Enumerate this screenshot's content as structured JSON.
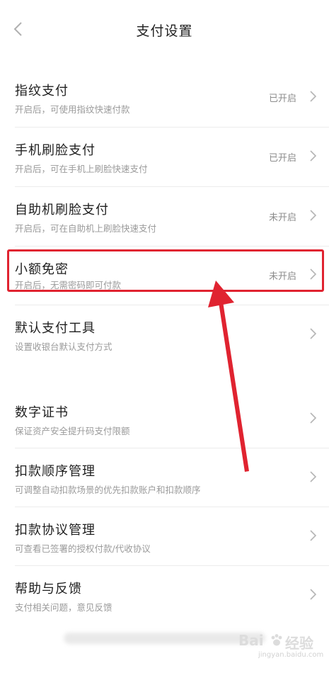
{
  "header": {
    "title": "支付设置"
  },
  "rows": [
    {
      "title": "指纹支付",
      "subtitle": "开启后，可使用指纹快速付款",
      "status": "已开启"
    },
    {
      "title": "手机刷脸支付",
      "subtitle": "开启后，可在手机上刷脸快速支付",
      "status": "已开启"
    },
    {
      "title": "自助机刷脸支付",
      "subtitle": "开启后，可在自助机上刷脸快速支付",
      "status": "未开启"
    },
    {
      "title": "小额免密",
      "subtitle": "开启后，无需密码即可付款",
      "status": "未开启"
    },
    {
      "title": "默认支付工具",
      "subtitle": "设置收银台默认支付方式",
      "status": ""
    },
    {
      "title": "数字证书",
      "subtitle": "保证资产安全提升码支付限额",
      "status": ""
    },
    {
      "title": "扣款顺序管理",
      "subtitle": "可调整自动扣款场景的优先扣款账户和扣款顺序",
      "status": ""
    },
    {
      "title": "扣款协议管理",
      "subtitle": "可查看已签署的授权付款/代收协议",
      "status": ""
    },
    {
      "title": "帮助与反馈",
      "subtitle": "支付相关问题，意见反馈",
      "status": ""
    }
  ],
  "watermark": {
    "brand": "Bai",
    "brand_suffix": "经验",
    "url": "jingyan.baidu.com"
  },
  "colors": {
    "highlight": "#e02330",
    "arrow": "#e02330"
  },
  "icons": {
    "back": "chevron-left-icon",
    "row": "chevron-right-icon"
  }
}
